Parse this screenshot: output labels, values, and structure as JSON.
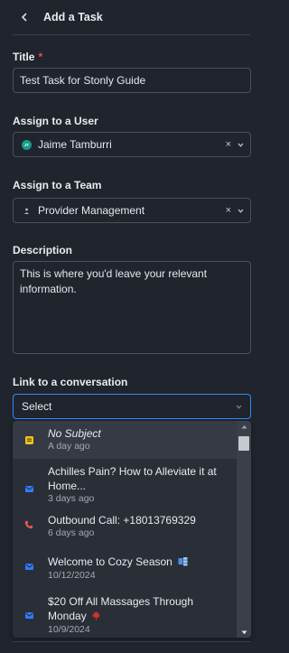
{
  "header": {
    "title": "Add a Task",
    "back_icon": "chevron-left-icon"
  },
  "title_field": {
    "label": "Title",
    "required_mark": "*",
    "value": "Test Task for Stonly Guide"
  },
  "assign_user": {
    "label": "Assign to a User",
    "avatar_initials": "JT",
    "value": "Jaime Tamburri",
    "clear": "×"
  },
  "assign_team": {
    "label": "Assign to a Team",
    "value": "Provider Management",
    "clear": "×"
  },
  "description": {
    "label": "Description",
    "value": "This is where you'd leave your relevant information."
  },
  "conversation": {
    "label": "Link to a conversation",
    "placeholder": "Select",
    "options": [
      {
        "icon": "note-icon",
        "title": "No Subject",
        "date": "A day ago",
        "italic": true
      },
      {
        "icon": "email-icon",
        "title": "Achilles Pain? How to Alleviate it at Home...",
        "date": "3 days ago"
      },
      {
        "icon": "phone-icon",
        "title": "Outbound Call: +18013769329",
        "date": "6 days ago"
      },
      {
        "icon": "email-icon",
        "title": "Welcome to Cozy Season",
        "date": "10/12/2024"
      },
      {
        "icon": "email-icon",
        "title": "$20 Off All Massages Through Monday",
        "date": "10/9/2024"
      }
    ]
  },
  "colors": {
    "background": "#20242d",
    "accent": "#2f8bff",
    "required": "#ef4a4a",
    "email": "#2f7df6",
    "note": "#f3c316",
    "phone": "#e0584f"
  }
}
